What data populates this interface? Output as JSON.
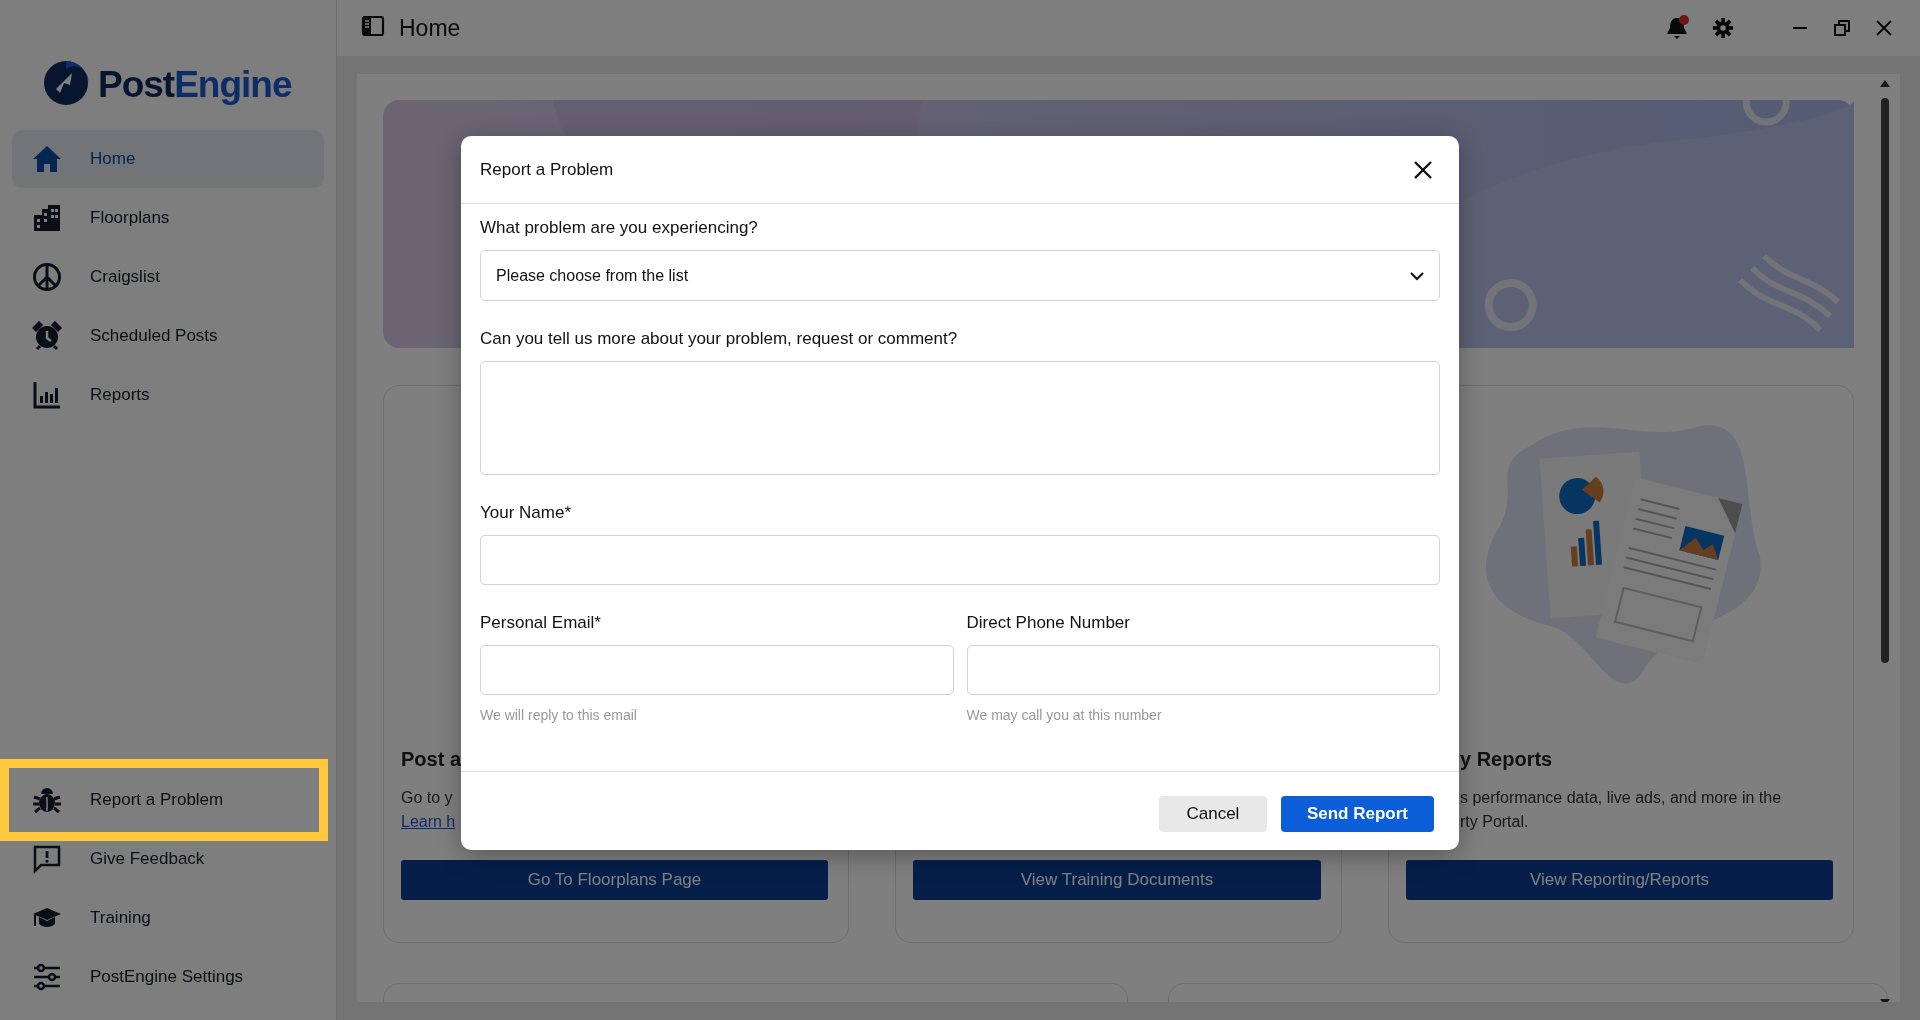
{
  "logo": {
    "first": "Post",
    "second": "Engine"
  },
  "topbar": {
    "title": "Home",
    "notifications": {
      "unread": true
    }
  },
  "sidebar": {
    "items": [
      {
        "label": "Home",
        "selected": true,
        "highlighted": false
      },
      {
        "label": "Floorplans",
        "selected": false,
        "highlighted": false
      },
      {
        "label": "Craigslist",
        "selected": false,
        "highlighted": false
      },
      {
        "label": "Scheduled Posts",
        "selected": false,
        "highlighted": false
      },
      {
        "label": "Reports",
        "selected": false,
        "highlighted": false
      }
    ],
    "bottom_items": [
      {
        "label": "Report a Problem",
        "selected": false,
        "highlighted": true
      },
      {
        "label": "Give Feedback",
        "selected": false,
        "highlighted": false
      },
      {
        "label": "Training",
        "selected": false,
        "highlighted": false
      },
      {
        "label": "PostEngine Settings",
        "selected": false,
        "highlighted": false
      }
    ]
  },
  "cards": [
    {
      "title": "Post a",
      "lines": [
        "Go to y"
      ],
      "link": "Learn h",
      "button": "Go To Floorplans Page"
    },
    {
      "button": "View Training Documents"
    },
    {
      "title": "y Reports",
      "lines": [
        "s performance data, live ads, and more in the",
        "rty Portal."
      ],
      "button": "View Reporting/Reports"
    }
  ],
  "dialog": {
    "title": "Report a Problem",
    "rows": [
      [
        {
          "kind": "select",
          "label": "What problem are you experiencing?",
          "value": "Please choose from the list"
        }
      ],
      [
        {
          "kind": "textarea",
          "label": "Can you tell us more about your problem, request or comment?"
        }
      ],
      [
        {
          "kind": "text",
          "label": "Your Name*"
        }
      ],
      [
        {
          "kind": "text",
          "label": "Personal Email*",
          "hint": "We will reply to this email"
        },
        {
          "kind": "text",
          "label": "Direct Phone Number",
          "hint": "We may call you at this number"
        }
      ]
    ],
    "buttons": [
      {
        "label": "Cancel",
        "kind": "secondary"
      },
      {
        "label": "Send Report",
        "kind": "primary"
      }
    ]
  }
}
